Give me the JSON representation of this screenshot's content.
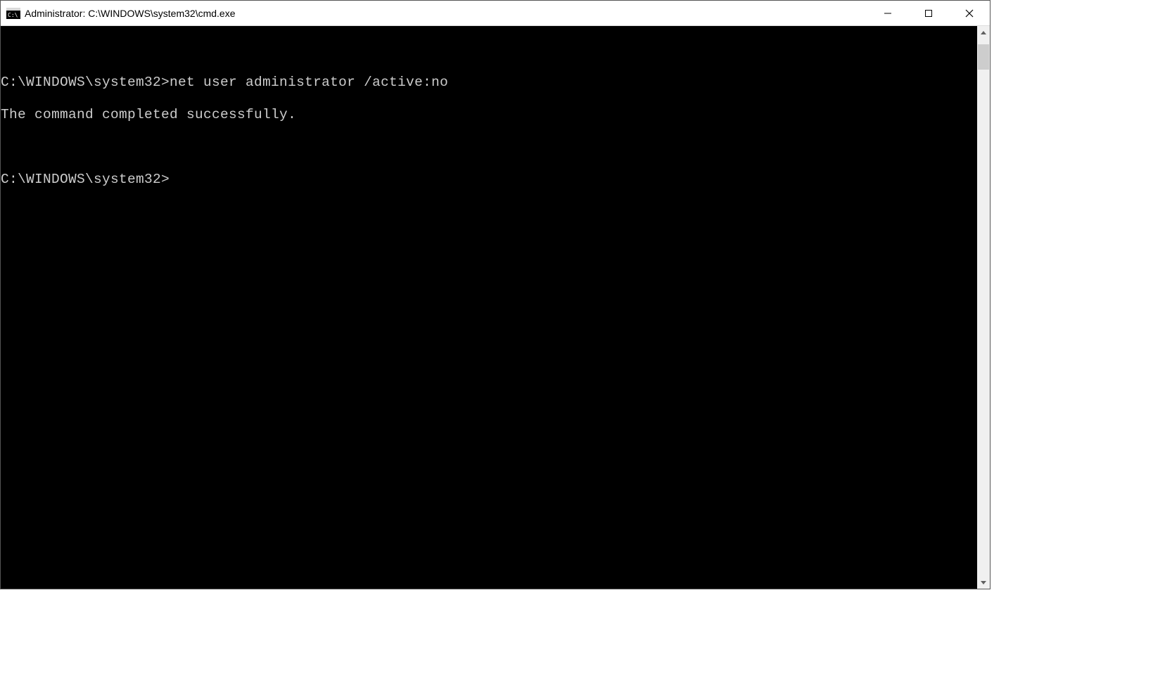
{
  "window": {
    "title": "Administrator: C:\\WINDOWS\\system32\\cmd.exe"
  },
  "terminal": {
    "lines": [
      "C:\\WINDOWS\\system32>net user administrator /active:no",
      "The command completed successfully.",
      "",
      "",
      "C:\\WINDOWS\\system32>"
    ]
  }
}
